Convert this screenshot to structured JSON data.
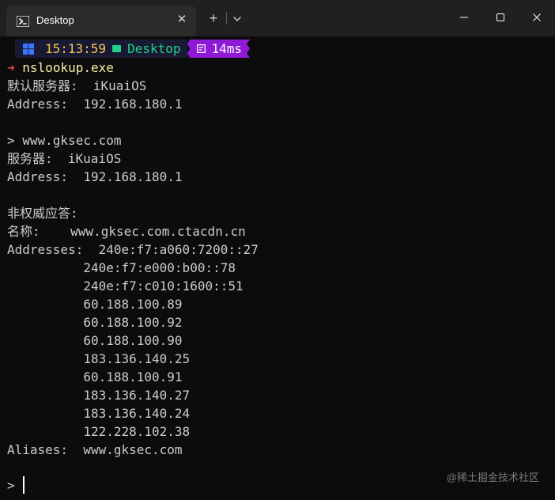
{
  "window": {
    "tab_title": "Desktop",
    "tab_close": "✕",
    "new_tab": "+",
    "icons": {
      "tab": "powershell-icon",
      "dropdown": "chevron-down-icon",
      "minimize": "minimize-icon",
      "maximize": "maximize-icon",
      "close": "close-icon"
    }
  },
  "prompt": {
    "time": "15:13:59",
    "path": "Desktop",
    "duration": "14ms",
    "arrow": "➜",
    "command": "nslookup.exe",
    "icons": {
      "os": "windows-logo-icon",
      "path": "folder-icon",
      "duration": "stopwatch-icon"
    },
    "colors": {
      "time": "#f9c74f",
      "path": "#23d18b",
      "duration_bg": "#8e19d6",
      "arrow": "#e74856",
      "command": "#f9f1a5"
    }
  },
  "output": {
    "lines": [
      "默认服务器:  iKuaiOS",
      "Address:  192.168.180.1",
      "",
      "> www.gksec.com",
      "服务器:  iKuaiOS",
      "Address:  192.168.180.1",
      "",
      "非权威应答:",
      "名称:    www.gksec.com.ctacdn.cn",
      "Addresses:  240e:f7:a060:7200::27",
      "          240e:f7:e000:b00::78",
      "          240e:f7:c010:1600::51",
      "          60.188.100.89",
      "          60.188.100.92",
      "          60.188.100.90",
      "          183.136.140.25",
      "          60.188.100.91",
      "          183.136.140.27",
      "          183.136.140.24",
      "          122.228.102.38",
      "Aliases:  www.gksec.com"
    ],
    "input_prompt": ">"
  },
  "watermark": "@稀土掘金技术社区"
}
